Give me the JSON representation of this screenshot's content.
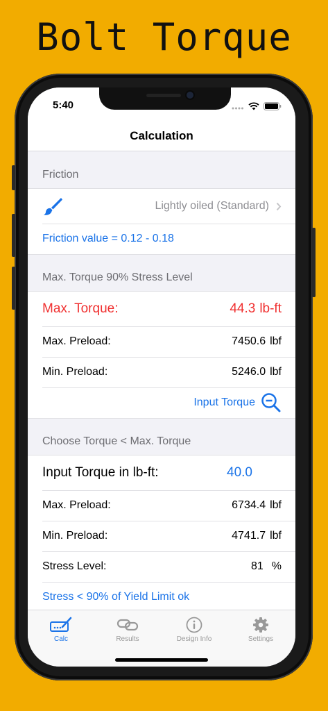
{
  "promo": {
    "title": "Bolt Torque"
  },
  "status_bar": {
    "time": "5:40"
  },
  "navbar": {
    "title": "Calculation"
  },
  "friction": {
    "header": "Friction",
    "selection": "Lightly oiled (Standard)",
    "note": "Friction value = 0.12 - 0.18"
  },
  "max_section": {
    "header": "Max. Torque 90% Stress Level",
    "max_torque_label": "Max. Torque:",
    "max_torque_value": "44.3",
    "max_torque_unit": "lb-ft",
    "max_preload_label": "Max. Preload:",
    "max_preload_value": "7450.6",
    "min_preload_label": "Min. Preload:",
    "min_preload_value": "5246.0",
    "preload_unit": "lbf",
    "input_torque_link": "Input Torque"
  },
  "choose_section": {
    "header": "Choose Torque < Max. Torque",
    "input_label": "Input Torque in lb-ft:",
    "input_value": "40.0",
    "max_preload_label": "Max. Preload:",
    "max_preload_value": "6734.4",
    "min_preload_label": "Min. Preload:",
    "min_preload_value": "4741.7",
    "preload_unit": "lbf",
    "stress_label": "Stress Level:",
    "stress_value": "81",
    "stress_unit": "%",
    "stress_note": "Stress < 90% of Yield Limit ok"
  },
  "tabs": [
    {
      "label": "Calc",
      "icon": "calc-icon",
      "active": true
    },
    {
      "label": "Results",
      "icon": "link-icon",
      "active": false
    },
    {
      "label": "Design Info",
      "icon": "info-icon",
      "active": false
    },
    {
      "label": "Settings",
      "icon": "gear-icon",
      "active": false
    }
  ],
  "colors": {
    "background": "#F2AC00",
    "accent": "#1A73E8",
    "alert": "#F03030"
  }
}
